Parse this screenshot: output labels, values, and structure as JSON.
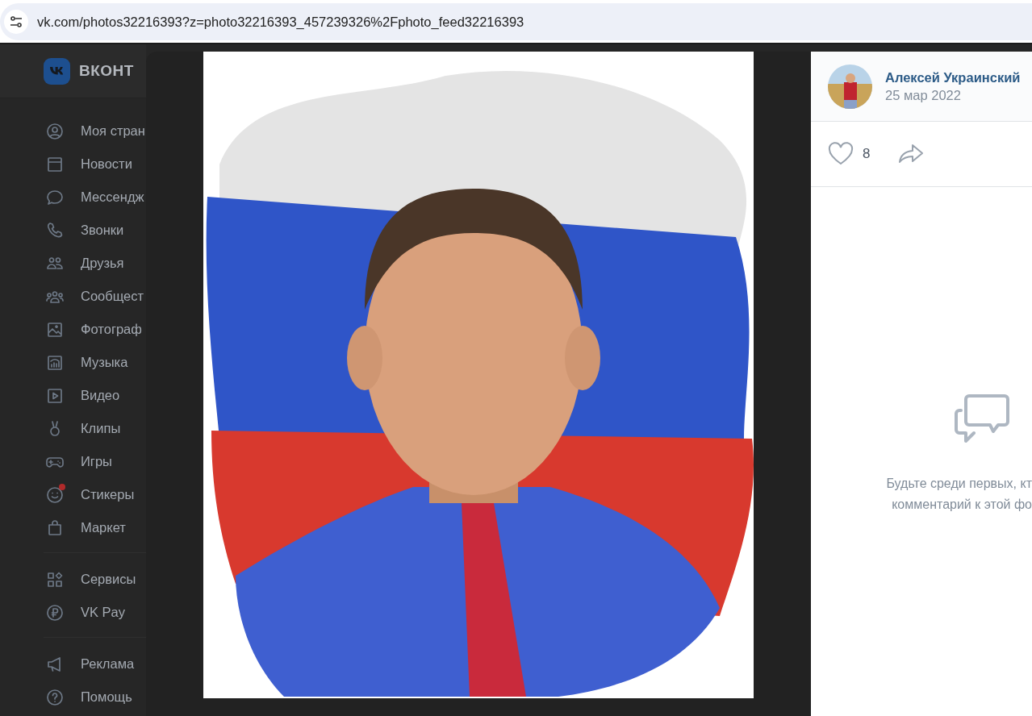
{
  "browser": {
    "url": "vk.com/photos32216393?z=photo32216393_457239326%2Fphoto_feed32216393"
  },
  "site": {
    "logo_text": "ВКОНТ"
  },
  "sidebar": {
    "sections": [
      {
        "items": [
          {
            "label": "Моя стран",
            "notification": false
          },
          {
            "label": "Новости",
            "notification": false
          },
          {
            "label": "Мессендж",
            "notification": false
          },
          {
            "label": "Звонки",
            "notification": false
          },
          {
            "label": "Друзья",
            "notification": false
          },
          {
            "label": "Сообщест",
            "notification": false
          },
          {
            "label": "Фотограф",
            "notification": false
          },
          {
            "label": "Музыка",
            "notification": false
          },
          {
            "label": "Видео",
            "notification": false
          },
          {
            "label": "Клипы",
            "notification": false
          },
          {
            "label": "Игры",
            "notification": false
          },
          {
            "label": "Стикеры",
            "notification": true
          },
          {
            "label": "Маркет",
            "notification": false
          }
        ]
      },
      {
        "items": [
          {
            "label": "Сервисы",
            "notification": false
          },
          {
            "label": "VK Pay",
            "notification": false
          }
        ]
      },
      {
        "items": [
          {
            "label": "Реклама",
            "notification": false
          },
          {
            "label": "Помощь",
            "notification": false
          }
        ]
      }
    ]
  },
  "photo_viewer": {
    "author": {
      "name": "Алексей Украинский",
      "date": "25 мар 2022"
    },
    "likes": {
      "count": "8",
      "liked": false
    },
    "comments": {
      "empty_text": [
        "Будьте среди первых, кт",
        "комментарий к этой фо"
      ]
    }
  }
}
